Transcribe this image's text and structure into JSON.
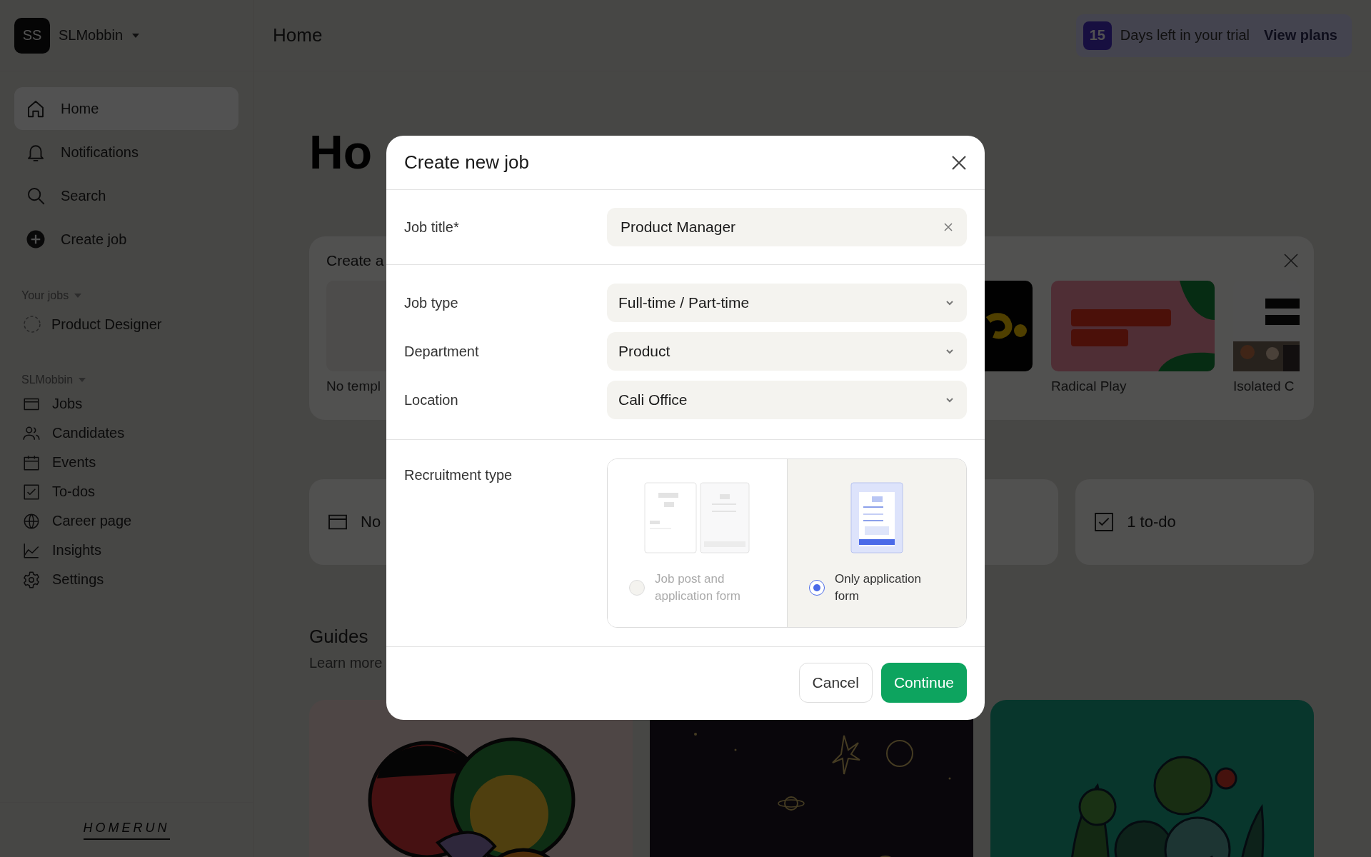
{
  "sidebar": {
    "workspace": {
      "avatar": "SS",
      "name": "SLMobbin"
    },
    "nav": [
      {
        "label": "Home",
        "selected": true
      },
      {
        "label": "Notifications",
        "selected": false
      },
      {
        "label": "Search",
        "selected": false
      },
      {
        "label": "Create job",
        "selected": false
      }
    ],
    "your_jobs": {
      "heading": "Your jobs",
      "items": [
        "Product Designer"
      ]
    },
    "workspace_section": {
      "heading": "SLMobbin",
      "items": [
        "Jobs",
        "Candidates",
        "Events",
        "To-dos",
        "Career page",
        "Insights",
        "Settings"
      ]
    },
    "logo": "HOMERUN"
  },
  "top_bar": {
    "title": "Home",
    "trial": {
      "days": "15",
      "text": "Days left in your trial",
      "link": "View plans"
    }
  },
  "page": {
    "heading": "Ho",
    "create_card": {
      "title": "Create a",
      "blank_label": "No templ",
      "templates": [
        "Radical Play",
        "Isolated C"
      ]
    },
    "stats": [
      {
        "label": "No"
      },
      {
        "label": "1 to-do"
      }
    ],
    "guides": {
      "title": "Guides",
      "subtitle": "Learn more"
    }
  },
  "modal": {
    "title": "Create new job",
    "fields": [
      {
        "label": "Job title*",
        "value": "Product Manager",
        "kind": "text"
      },
      {
        "label": "Job type",
        "value": "Full-time / Part-time",
        "kind": "select"
      },
      {
        "label": "Department",
        "value": "Product",
        "kind": "select"
      },
      {
        "label": "Location",
        "value": "Cali Office",
        "kind": "select"
      }
    ],
    "recruitment": {
      "label": "Recruitment type",
      "options": [
        {
          "label": "Job post and application form",
          "selected": false
        },
        {
          "label": "Only application form",
          "selected": true
        }
      ]
    },
    "buttons": [
      {
        "label": "Cancel",
        "kind": "secondary"
      },
      {
        "label": "Continue",
        "kind": "primary"
      }
    ]
  }
}
